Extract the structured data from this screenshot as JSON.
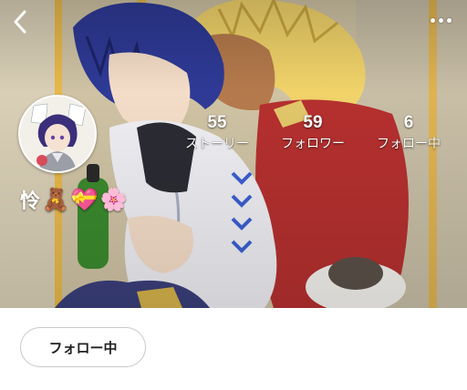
{
  "header": {
    "back_icon": "chevron-left-icon",
    "more_icon": "more-horizontal-icon",
    "icon_color": "#ffffff"
  },
  "profile": {
    "name": "怜",
    "name_emojis": [
      "🧸",
      "💝",
      "🌸"
    ],
    "avatar_icon": "user-avatar-icon"
  },
  "stats": {
    "stories": {
      "value": "55",
      "label": "ストーリー"
    },
    "followers": {
      "value": "59",
      "label": "フォロワー"
    },
    "following": {
      "value": "6",
      "label": "フォロー中"
    }
  },
  "actions": {
    "follow_status_label": "フォロー中"
  },
  "colors": {
    "button_border": "#c9c9c9",
    "text_dark": "#222222"
  }
}
